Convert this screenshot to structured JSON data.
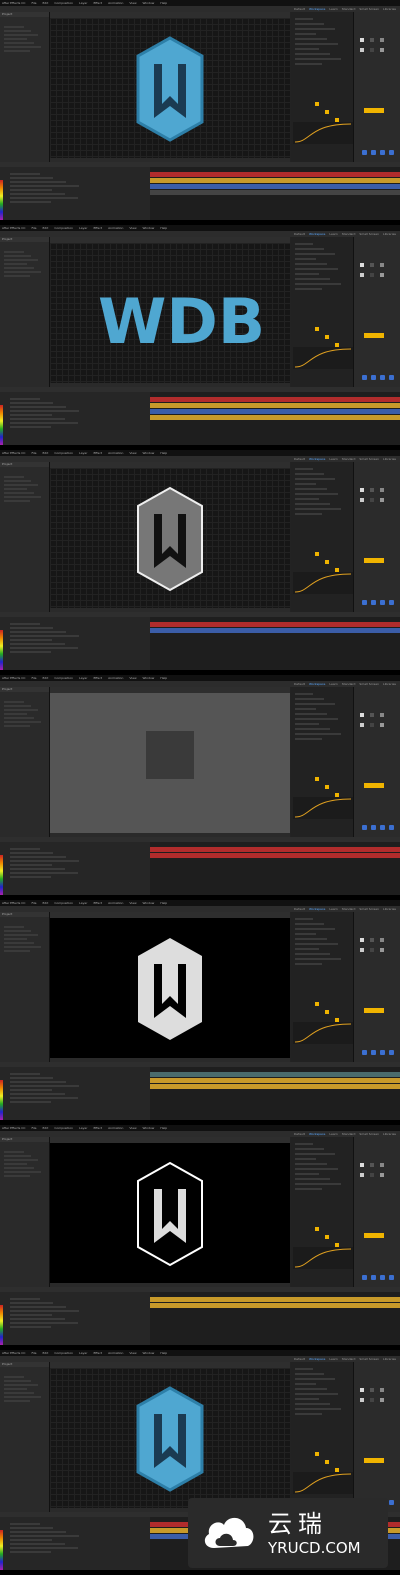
{
  "app": {
    "menu": [
      "After Effects CC",
      "File",
      "Edit",
      "Composition",
      "Layer",
      "Effect",
      "Animation",
      "View",
      "Window",
      "Help"
    ],
    "workspaces": [
      "Default",
      "Workspace",
      "Learn",
      "Standard",
      "Small Screen",
      "Libraries"
    ],
    "active_workspace": "Workspace"
  },
  "panels": {
    "project_label": "Project",
    "composition_label": "Composition",
    "timeline_label": "Timeline",
    "effects_label": "Effects & Presets",
    "render_label": "Render Queue"
  },
  "shots": [
    {
      "id": "s1",
      "variant": "hex-blue",
      "track_colors": [
        "#b12c2c",
        "#c89a2a",
        "#3b5da8",
        "#444"
      ],
      "has_watermark_overlap": false
    },
    {
      "id": "s2",
      "variant": "wdb-blue",
      "track_colors": [
        "#b12c2c",
        "#c89a2a",
        "#3b5da8",
        "#c89a2a"
      ],
      "has_watermark_overlap": false
    },
    {
      "id": "s3",
      "variant": "hex-noise",
      "track_colors": [
        "#b12c2c",
        "#3b5da8"
      ],
      "has_watermark_overlap": false
    },
    {
      "id": "s4",
      "variant": "noise-grid",
      "track_colors": [
        "#b12c2c",
        "#b12c2c"
      ],
      "has_watermark_overlap": false
    },
    {
      "id": "s5",
      "variant": "hex-white",
      "track_colors": [
        "#4a6b6b",
        "#c89a2a",
        "#c89a2a"
      ],
      "has_watermark_overlap": false
    },
    {
      "id": "s6",
      "variant": "hex-outline",
      "track_colors": [
        "#c89a2a",
        "#c89a2a"
      ],
      "has_watermark_overlap": false
    },
    {
      "id": "s7",
      "variant": "hex-blue",
      "track_colors": [
        "#b12c2c",
        "#c89a2a",
        "#3b5da8"
      ],
      "has_watermark_overlap": true
    }
  ],
  "colors": {
    "accent_blue": "#3b6fd1",
    "accent_yellow": "#f0b400",
    "hex_blue": "#4fa7d1"
  },
  "watermark": {
    "chinese": "云瑞",
    "domain": "YRUCD.COM"
  }
}
